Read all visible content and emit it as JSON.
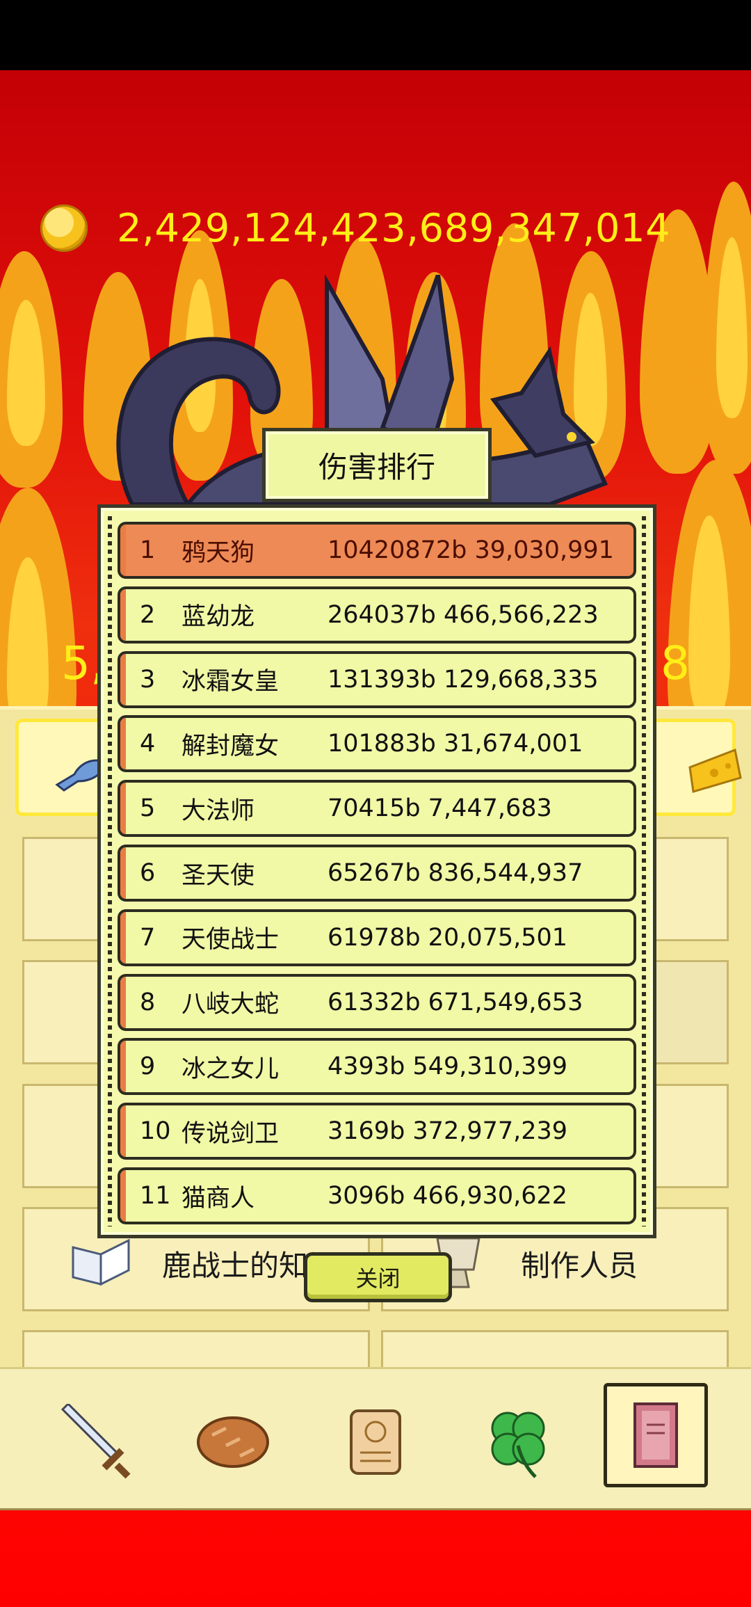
{
  "status_bar": {},
  "currency": {
    "amount": "2,429,124,423,689,347,014",
    "icon": "gold-coin-icon"
  },
  "boss": {
    "hp_left_partial": "5,",
    "hp_right_partial": "8"
  },
  "ranking": {
    "title": "伤害排行",
    "rows": [
      {
        "rank": "1",
        "name": "鸦天狗",
        "damage": "10420872b 39,030,991"
      },
      {
        "rank": "2",
        "name": "蓝幼龙",
        "damage": "264037b 466,566,223"
      },
      {
        "rank": "3",
        "name": "冰霜女皇",
        "damage": "131393b 129,668,335"
      },
      {
        "rank": "4",
        "name": "解封魔女",
        "damage": "101883b 31,674,001"
      },
      {
        "rank": "5",
        "name": "大法师",
        "damage": "70415b 7,447,683"
      },
      {
        "rank": "6",
        "name": "圣天使",
        "damage": "65267b 836,544,937"
      },
      {
        "rank": "7",
        "name": "天使战士",
        "damage": "61978b 20,075,501"
      },
      {
        "rank": "8",
        "name": "八岐大蛇",
        "damage": "61332b 671,549,653"
      },
      {
        "rank": "9",
        "name": "冰之女儿",
        "damage": "4393b 549,310,399"
      },
      {
        "rank": "10",
        "name": "传说剑卫",
        "damage": "3169b 372,977,239"
      },
      {
        "rank": "11",
        "name": "猫商人",
        "damage": "3096b 466,930,622"
      }
    ],
    "close_label": "关闭"
  },
  "menu": {
    "tile_left_label": "鹿战士的知识",
    "tile_right_label": "制作人员"
  },
  "bottom_nav": {
    "items": [
      {
        "icon": "sword-icon"
      },
      {
        "icon": "bread-icon"
      },
      {
        "icon": "scroll-icon"
      },
      {
        "icon": "clover-icon"
      },
      {
        "icon": "book-icon",
        "active": true
      }
    ]
  },
  "colors": {
    "background_red": "#e2110a",
    "gold_text": "#ffee18",
    "board_fill": "#f5f9ad",
    "top_rank_fill": "#ee8a56",
    "panel_fill": "#f3e7a0"
  }
}
